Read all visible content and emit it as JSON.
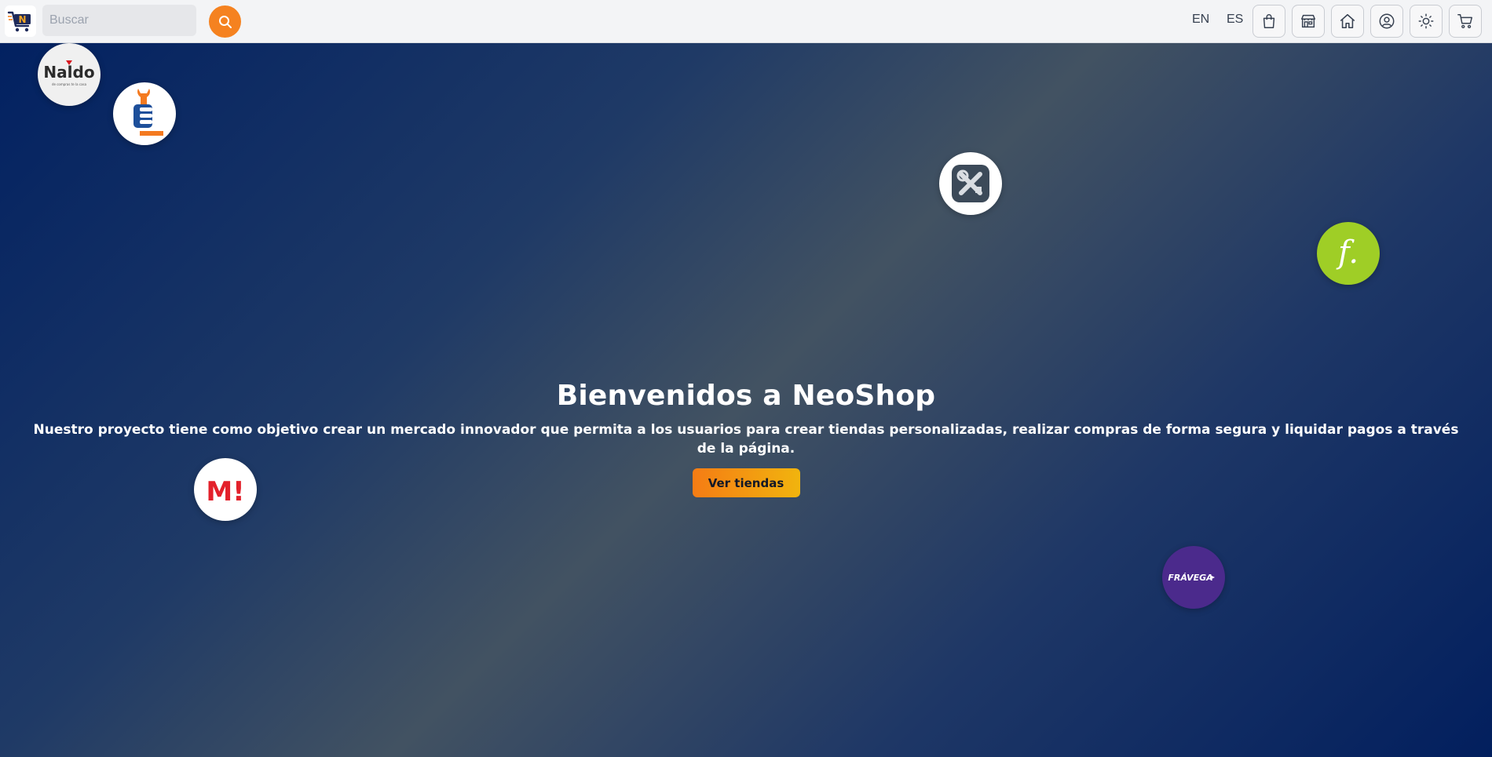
{
  "header": {
    "logo_letter": "N",
    "search": {
      "placeholder": "Buscar",
      "value": ""
    },
    "languages": [
      "EN",
      "ES"
    ],
    "icons": [
      "bag-icon",
      "store-icon",
      "home-icon",
      "user-icon",
      "theme-sun-icon",
      "cart-icon"
    ]
  },
  "hero": {
    "title": "Bienvenidos a NeoShop",
    "description": "Nuestro proyecto tiene como objetivo crear un mercado innovador que permita a los usuarios para crear tiendas personalizadas, realizar compras de forma segura y liquidar pagos a través de la página.",
    "cta_label": "Ver tiendas"
  },
  "stores": {
    "naldo": {
      "name": "Naldo",
      "tagline": "de compras te la casa"
    },
    "tools": {
      "name": "tools-store"
    },
    "repair": {
      "name": "repair-store"
    },
    "falabella": {
      "name": "f."
    },
    "musimundo": {
      "name": "M!"
    },
    "fravega": {
      "name": "FRÁVEGA"
    }
  },
  "colors": {
    "accent_orange": "#f58220",
    "cta_gradient_start": "#f57c14",
    "cta_gradient_end": "#f1b40e",
    "hero_dark": "#022161",
    "hero_light": "#425262"
  }
}
